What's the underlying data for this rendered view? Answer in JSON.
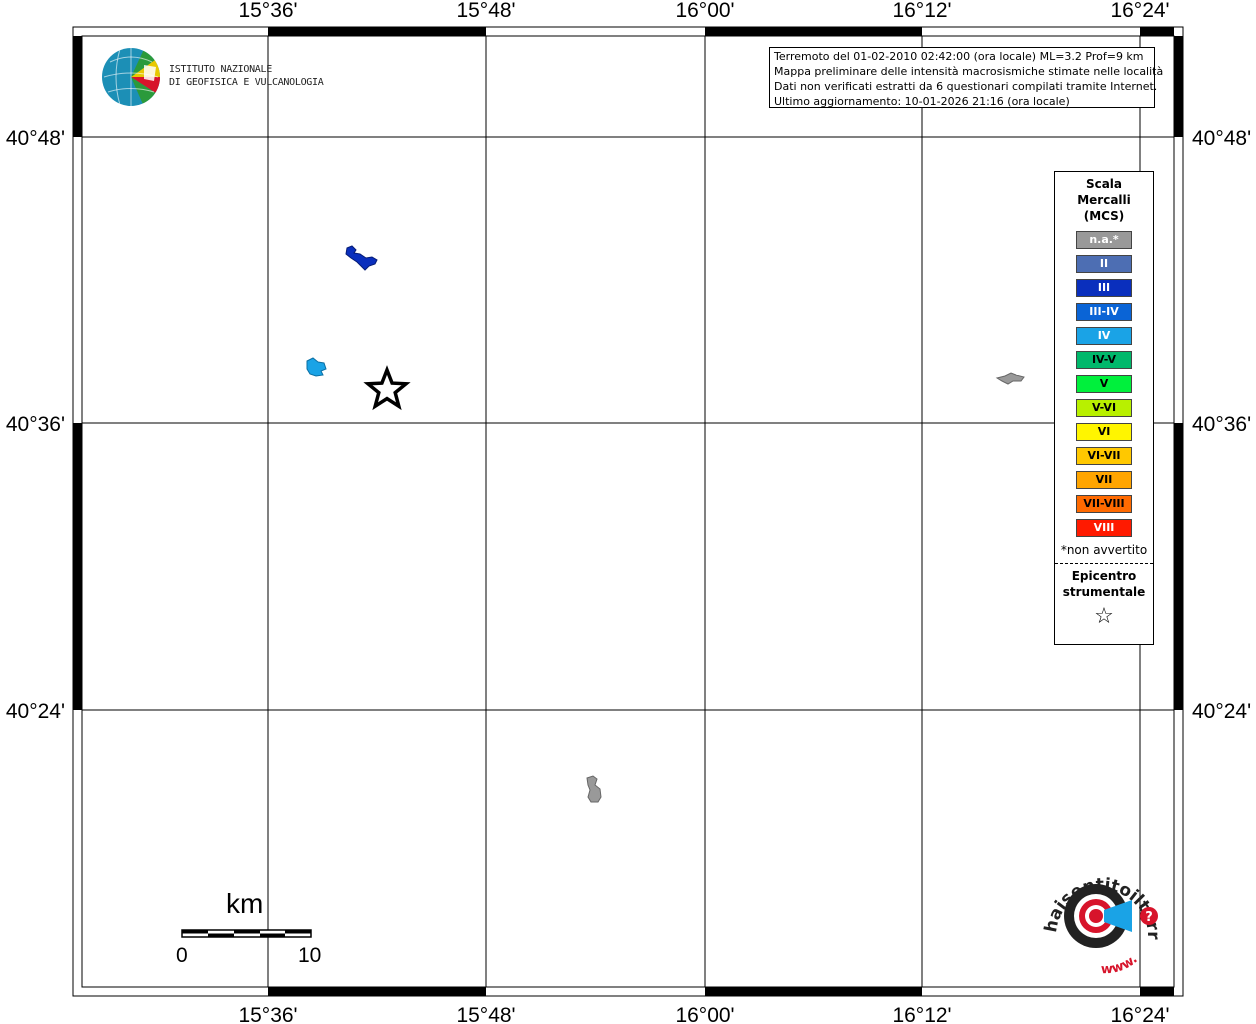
{
  "map": {
    "lon_ticks": [
      "15°36'",
      "15°48'",
      "16°00'",
      "16°12'",
      "16°24'"
    ],
    "lat_ticks": [
      "40°48'",
      "40°36'",
      "40°24'"
    ]
  },
  "info": {
    "line1": "Terremoto del 01-02-2010 02:42:00 (ora locale) ML=3.2 Prof=9 km",
    "line2": "Mappa preliminare delle intensità macrosismiche stimate nelle località",
    "line3": "Dati non verificati estratti da 6 questionari compilati tramite Internet.",
    "line4": "Ultimo aggiornamento: 10-01-2026 21:16 (ora locale)"
  },
  "legend": {
    "title1": "Scala",
    "title2": "Mercalli",
    "title3": "(MCS)",
    "items": [
      {
        "label": "n.a.*",
        "color": "#999999",
        "text_color": "#ffffff"
      },
      {
        "label": "II",
        "color": "#4d6eb3",
        "text_color": "#ffffff"
      },
      {
        "label": "III",
        "color": "#0a2fbd",
        "text_color": "#ffffff"
      },
      {
        "label": "III-IV",
        "color": "#0a64d6",
        "text_color": "#ffffff"
      },
      {
        "label": "IV",
        "color": "#1aa3e6",
        "text_color": "#ffffff"
      },
      {
        "label": "IV-V",
        "color": "#00b86b",
        "text_color": "#000000"
      },
      {
        "label": "V",
        "color": "#00f03c",
        "text_color": "#000000"
      },
      {
        "label": "V-VI",
        "color": "#b8f000",
        "text_color": "#000000"
      },
      {
        "label": "VI",
        "color": "#fff500",
        "text_color": "#000000"
      },
      {
        "label": "VI-VII",
        "color": "#ffc800",
        "text_color": "#000000"
      },
      {
        "label": "VII",
        "color": "#ffa500",
        "text_color": "#000000"
      },
      {
        "label": "VII-VIII",
        "color": "#ff6a00",
        "text_color": "#000000"
      },
      {
        "label": "VIII",
        "color": "#ff1a00",
        "text_color": "#ffffff"
      }
    ],
    "note": "*non avvertito",
    "epi1": "Epicentro",
    "epi2": "strumentale",
    "star": "☆"
  },
  "logo": {
    "line1": "ISTITUTO NAZIONALE",
    "line2": "DI GEOFISICA E VULCANOLOGIA"
  },
  "scalebar": {
    "unit": "km",
    "label_start": "0",
    "label_end": "10"
  },
  "hsit": {
    "text": "haisentitoilterremoto.it",
    "prefix": "www."
  }
}
